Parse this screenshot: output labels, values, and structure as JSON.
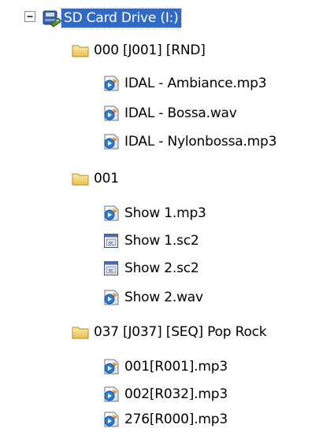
{
  "tree": {
    "root": {
      "label": "SD Card Drive (I:)",
      "expander_state": "expanded",
      "icon": "removable-drive-icon"
    },
    "folders": [
      {
        "label": "000 [J001] [RND]",
        "icon": "folder-icon",
        "files": [
          {
            "label": "IDAL - Ambiance.mp3",
            "icon": "audio-file-icon"
          },
          {
            "label": "IDAL - Bossa.wav",
            "icon": "audio-file-icon"
          },
          {
            "label": "IDAL - Nylonbossa.mp3",
            "icon": "audio-file-icon"
          }
        ]
      },
      {
        "label": "001",
        "icon": "folder-icon",
        "files": [
          {
            "label": "Show 1.mp3",
            "icon": "audio-file-icon"
          },
          {
            "label": "Show 1.sc2",
            "icon": "sc2-file-icon"
          },
          {
            "label": "Show 2.sc2",
            "icon": "sc2-file-icon"
          },
          {
            "label": "Show 2.wav",
            "icon": "audio-file-icon"
          }
        ]
      },
      {
        "label": "037 [J037] [SEQ] Pop Rock",
        "icon": "folder-icon",
        "files": [
          {
            "label": "001[R001].mp3",
            "icon": "audio-file-icon"
          },
          {
            "label": "002[R032].mp3",
            "icon": "audio-file-icon"
          },
          {
            "label": "276[R000].mp3",
            "icon": "audio-file-icon"
          }
        ]
      }
    ]
  },
  "colors": {
    "selection": "#316ac5",
    "folder": "#f3d57a",
    "expander_border": "#8a8a8a"
  }
}
